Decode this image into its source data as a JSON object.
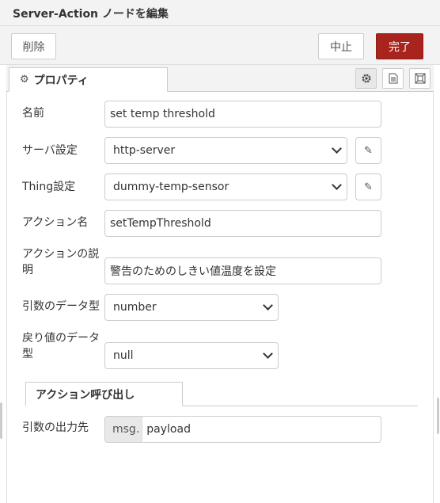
{
  "header": {
    "title": "Server-Action ノードを編集"
  },
  "toolbar": {
    "delete_label": "削除",
    "cancel_label": "中止",
    "done_label": "完了"
  },
  "tabs": {
    "properties_label": "プロパティ",
    "properties_icon": "gear-icon",
    "side_icons": [
      "gear-icon",
      "document-icon",
      "frame-icon"
    ]
  },
  "form": {
    "name_label": "名前",
    "name_value": "set temp threshold",
    "server_label": "サーバ設定",
    "server_value": "http-server",
    "thing_label": "Thing設定",
    "thing_value": "dummy-temp-sensor",
    "action_name_label": "アクション名",
    "action_name_value": "setTempThreshold",
    "action_desc_label": "アクションの説明",
    "action_desc_line1": "アクションの説",
    "action_desc_line2": "明",
    "action_desc_value": "警告のためのしきい値温度を設定",
    "arg_type_label": "引数のデータ型",
    "arg_type_value": "number",
    "return_type_line1": "戻り値のデータ",
    "return_type_line2": "型",
    "return_type_value": "null"
  },
  "action_call": {
    "tab_label": "アクション呼び出し",
    "output_label": "引数の出力先",
    "output_prefix": "msg.",
    "output_value": "payload"
  },
  "colors": {
    "done_button": "#a8241c",
    "header_bg": "#f3f3f3",
    "border": "#cccccc"
  }
}
